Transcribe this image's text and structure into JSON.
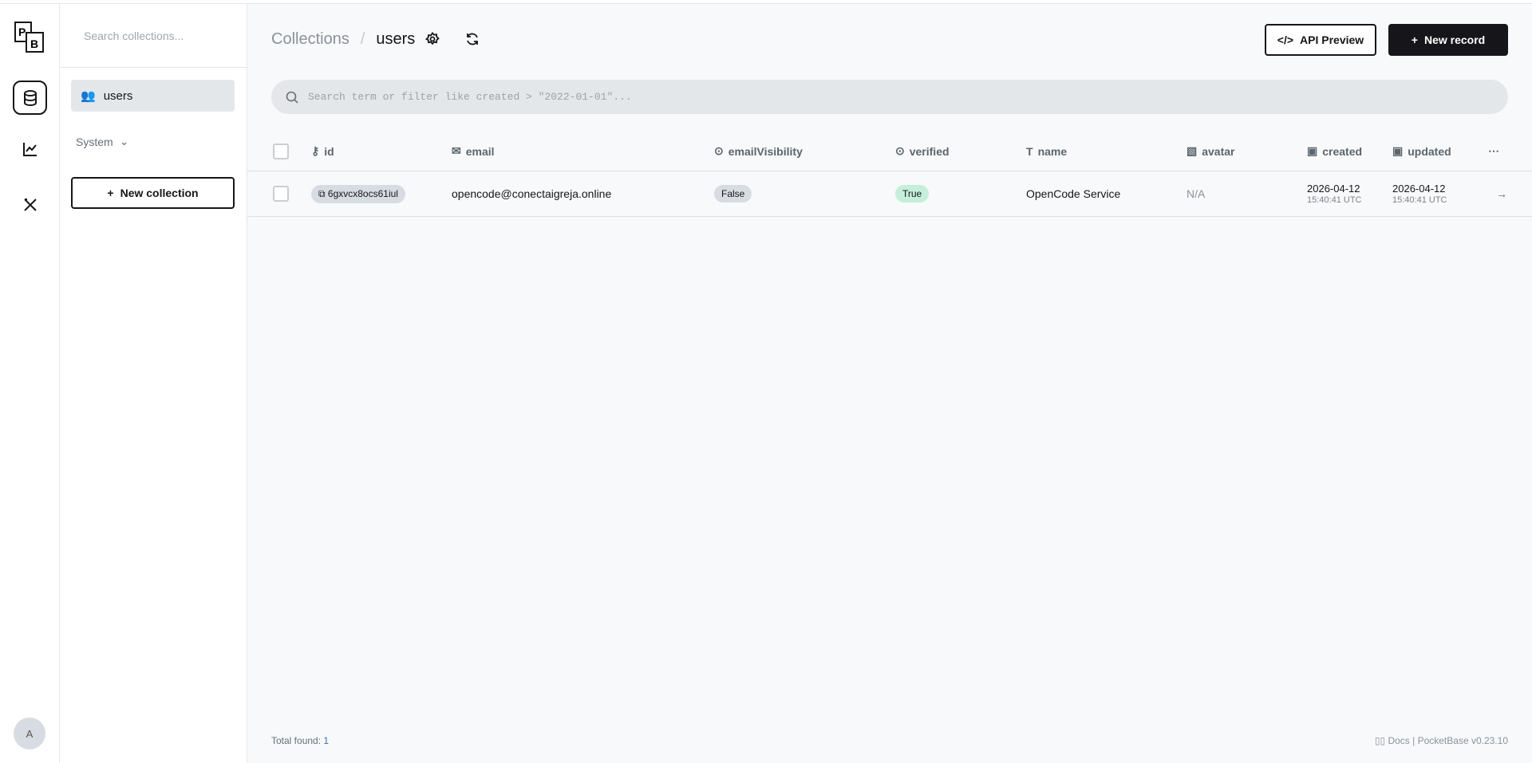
{
  "rail": {
    "logo": "PB",
    "items": [
      "collections",
      "logs",
      "settings"
    ],
    "avatar": "A"
  },
  "sidebar": {
    "search_placeholder": "Search collections...",
    "collections": [
      {
        "label": "users"
      }
    ],
    "system_label": "System",
    "new_collection": "New collection"
  },
  "header": {
    "breadcrumb_root": "Collections",
    "breadcrumb_current": "users",
    "api_preview": "API Preview",
    "new_record": "New record"
  },
  "search": {
    "placeholder": "Search term or filter like created > \"2022-01-01\"..."
  },
  "table": {
    "columns": [
      "id",
      "email",
      "emailVisibility",
      "verified",
      "name",
      "avatar",
      "created",
      "updated"
    ],
    "rows": [
      {
        "id": "6gxvcx8ocs61iul",
        "email": "opencode@conectaigreja.online",
        "emailVisibility": "False",
        "verified": "True",
        "name": "OpenCode Service",
        "avatar": "N/A",
        "created_date": "2026-04-12",
        "created_time": "15:40:41 UTC",
        "updated_date": "2026-04-12",
        "updated_time": "15:40:41 UTC"
      }
    ]
  },
  "footer": {
    "total_label": "Total found:",
    "total": "1",
    "docs": "Docs",
    "version": "PocketBase v0.23.10"
  },
  "colors": {
    "accent": "#16161a",
    "true_bg": "#c5efdb",
    "false_bg": "#d7dce2"
  }
}
